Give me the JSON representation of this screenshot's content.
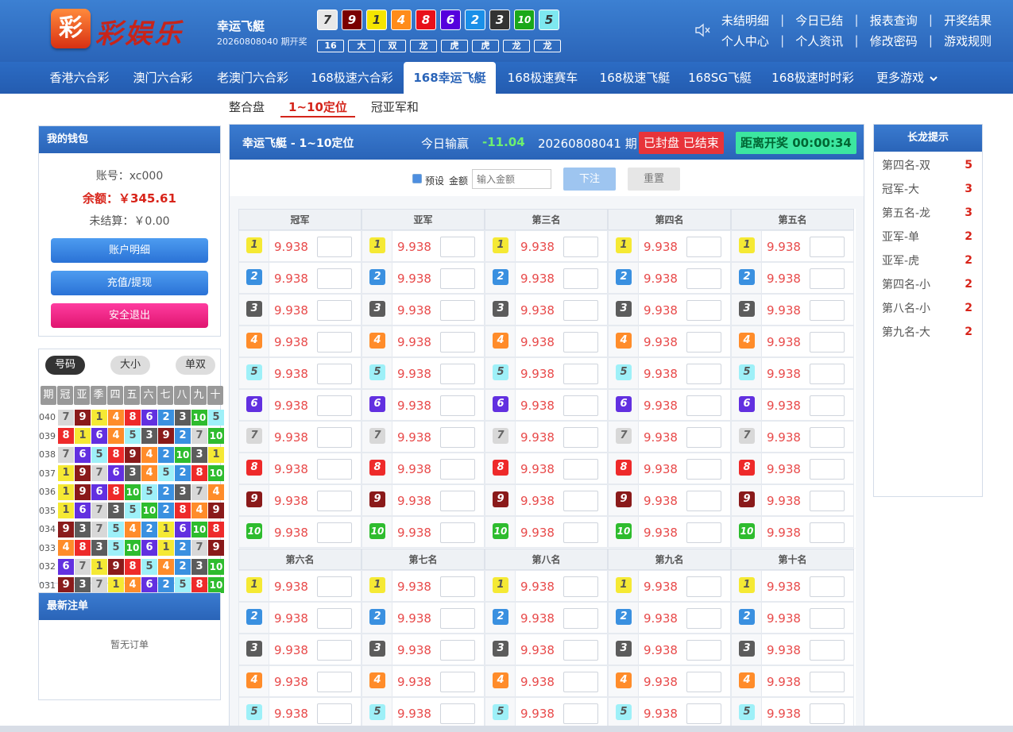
{
  "header": {
    "logo_char": "彩",
    "logo_text": "彩娱乐",
    "game_title": "幸运飞艇",
    "issue_text": "20260808040 期开奖",
    "result_balls": [
      {
        "n": "7",
        "color": "#e8e8e8",
        "fg": "#333"
      },
      {
        "n": "9",
        "color": "#7a0000",
        "fg": "#fff"
      },
      {
        "n": "1",
        "color": "#f5e500",
        "fg": "#333"
      },
      {
        "n": "4",
        "color": "#ff8c1a",
        "fg": "#fff"
      },
      {
        "n": "8",
        "color": "#e8101a",
        "fg": "#fff"
      },
      {
        "n": "6",
        "color": "#5500dd",
        "fg": "#fff"
      },
      {
        "n": "2",
        "color": "#1a8fe8",
        "fg": "#fff"
      },
      {
        "n": "3",
        "color": "#333333",
        "fg": "#fff"
      },
      {
        "n": "10",
        "color": "#1aa81a",
        "fg": "#fff"
      },
      {
        "n": "5",
        "color": "#7ee8f0",
        "fg": "#333"
      }
    ],
    "stats": [
      "16",
      "大",
      "双",
      "龙",
      "虎",
      "虎",
      "龙",
      "龙"
    ],
    "links_row1": [
      "未结明细",
      "今日已结",
      "报表查询",
      "开奖结果"
    ],
    "links_row2": [
      "个人中心",
      "个人资讯",
      "修改密码",
      "游戏规则"
    ]
  },
  "nav": {
    "items": [
      "香港六合彩",
      "澳门六合彩",
      "老澳门六合彩",
      "168极速六合彩",
      "168幸运飞艇",
      "168极速赛车",
      "168极速飞艇",
      "168SG飞艇",
      "168极速时时彩",
      "更多游戏"
    ],
    "active": "168幸运飞艇"
  },
  "subtabs": {
    "items": [
      "整合盘",
      "1~10定位",
      "冠亚军和"
    ],
    "active": "1~10定位"
  },
  "wallet": {
    "title": "我的钱包",
    "account": "账号：xc000",
    "balance": "余额：￥345.61",
    "unsettled": "未结算：￥0.00",
    "btn_detail": "账户明细",
    "btn_recharge": "充值/提现",
    "btn_logout": "安全退出"
  },
  "history": {
    "tabs": [
      "号码",
      "大小",
      "单双"
    ],
    "active_tab": "号码",
    "columns": [
      "期",
      "冠",
      "亚",
      "季",
      "四",
      "五",
      "六",
      "七",
      "八",
      "九",
      "十"
    ],
    "rows": [
      {
        "issue": "040",
        "nums": [
          7,
          9,
          1,
          4,
          8,
          6,
          2,
          3,
          10,
          5
        ]
      },
      {
        "issue": "039",
        "nums": [
          8,
          1,
          6,
          4,
          5,
          3,
          9,
          2,
          7,
          10
        ]
      },
      {
        "issue": "038",
        "nums": [
          7,
          6,
          5,
          8,
          9,
          4,
          2,
          10,
          3,
          1
        ]
      },
      {
        "issue": "037",
        "nums": [
          1,
          9,
          7,
          6,
          3,
          4,
          5,
          2,
          8,
          10
        ]
      },
      {
        "issue": "036",
        "nums": [
          1,
          9,
          6,
          8,
          10,
          5,
          2,
          3,
          7,
          4
        ]
      },
      {
        "issue": "035",
        "nums": [
          1,
          6,
          7,
          3,
          5,
          10,
          2,
          8,
          4,
          9
        ]
      },
      {
        "issue": "034",
        "nums": [
          9,
          3,
          7,
          5,
          4,
          2,
          1,
          6,
          10,
          8
        ]
      },
      {
        "issue": "033",
        "nums": [
          4,
          8,
          3,
          5,
          10,
          6,
          1,
          2,
          7,
          9
        ]
      },
      {
        "issue": "032",
        "nums": [
          6,
          7,
          1,
          9,
          8,
          5,
          4,
          2,
          3,
          10
        ]
      },
      {
        "issue": "031",
        "nums": [
          9,
          3,
          7,
          1,
          4,
          6,
          2,
          5,
          8,
          10
        ]
      }
    ]
  },
  "orders": {
    "title": "最新注单",
    "empty": "暂无订单"
  },
  "main": {
    "title": "幸运飞艇 - 1~10定位",
    "today_label": "今日输赢",
    "today_value": "-11.04",
    "issue": "20260808041 期",
    "status": "已封盘 已结束",
    "countdown": "距离开奖 00:00:34",
    "preset_label": "预设",
    "amount_label": "金额",
    "amount_placeholder": "输入金额",
    "bet_btn": "下注",
    "reset_btn": "重置",
    "odds": "9.938",
    "positions_top": [
      "冠军",
      "亚军",
      "第三名",
      "第四名",
      "第五名"
    ],
    "positions_bottom": [
      "第六名",
      "第七名",
      "第八名",
      "第九名",
      "第十名"
    ],
    "numbers": [
      "1",
      "2",
      "3",
      "4",
      "5",
      "6",
      "7",
      "8",
      "9",
      "10"
    ]
  },
  "ball_colors": {
    "1": {
      "bg": "#f5e934",
      "fg": "#555"
    },
    "2": {
      "bg": "#3a90e0",
      "fg": "#fff"
    },
    "3": {
      "bg": "#5c5c5c",
      "fg": "#fff"
    },
    "4": {
      "bg": "#ff8c2a",
      "fg": "#fff"
    },
    "5": {
      "bg": "#9ef0f8",
      "fg": "#555"
    },
    "6": {
      "bg": "#6230e0",
      "fg": "#fff"
    },
    "7": {
      "bg": "#d8d8d8",
      "fg": "#666"
    },
    "8": {
      "bg": "#ee2a2a",
      "fg": "#fff"
    },
    "9": {
      "bg": "#8a1a1a",
      "fg": "#fff"
    },
    "10": {
      "bg": "#2ebc2e",
      "fg": "#fff"
    }
  },
  "dragon": {
    "title": "长龙提示",
    "items": [
      {
        "k": "第四名-双",
        "v": "5"
      },
      {
        "k": "冠军-大",
        "v": "3"
      },
      {
        "k": "第五名-龙",
        "v": "3"
      },
      {
        "k": "亚军-单",
        "v": "2"
      },
      {
        "k": "亚军-虎",
        "v": "2"
      },
      {
        "k": "第四名-小",
        "v": "2"
      },
      {
        "k": "第八名-小",
        "v": "2"
      },
      {
        "k": "第九名-大",
        "v": "2"
      }
    ]
  }
}
